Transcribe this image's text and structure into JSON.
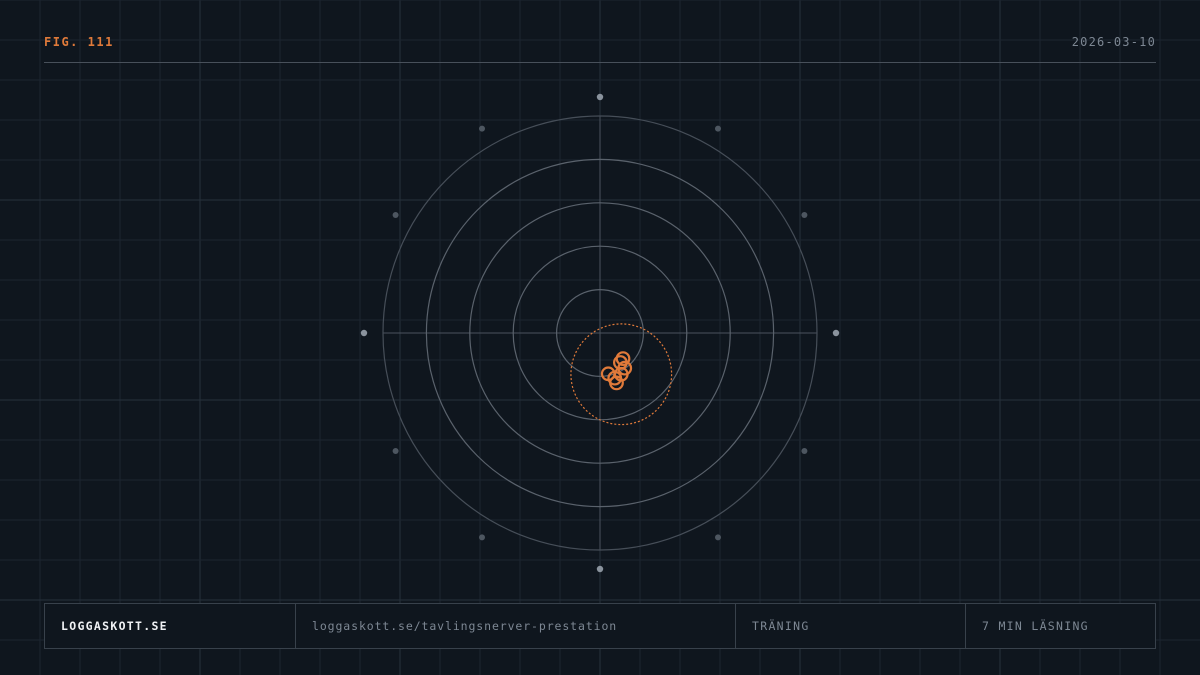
{
  "header": {
    "figure_label": "FIG. 111",
    "date": "2026-03-10"
  },
  "footer": {
    "site": "LOGGASKOTT.SE",
    "url": "loggaskott.se/tavlingsnerver-prestation",
    "category": "TRÄNING",
    "read_time": "7 MIN LÄSNING"
  },
  "colors": {
    "background": "#0f161e",
    "accent": "#e07a3a",
    "ring": "#5a626c",
    "grid": "#1c2530"
  },
  "target": {
    "rings": 5,
    "shots": [
      {
        "x": 0.53,
        "y": -0.59
      },
      {
        "x": 0.47,
        "y": -0.68
      },
      {
        "x": 0.57,
        "y": -0.81
      },
      {
        "x": 0.49,
        "y": -0.95
      },
      {
        "x": 0.34,
        "y": -1.04
      },
      {
        "x": 0.19,
        "y": -0.94
      },
      {
        "x": 0.38,
        "y": -1.15
      }
    ],
    "group_center": {
      "x": 0.49,
      "y": -0.95
    },
    "group_radius": 0.58
  }
}
